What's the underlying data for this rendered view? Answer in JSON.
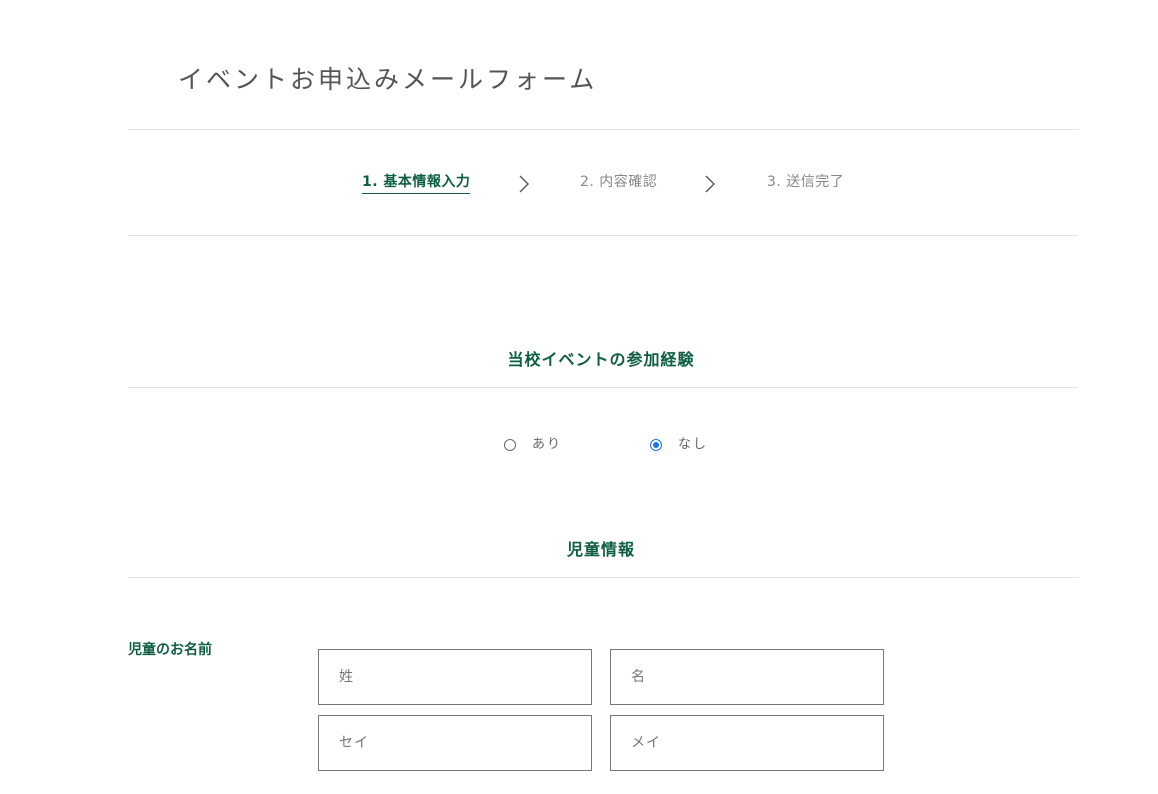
{
  "header": {
    "title": "イベントお申込みメールフォーム"
  },
  "steps": [
    {
      "label": "1. 基本情報入力",
      "active": true
    },
    {
      "label": "2. 内容確認",
      "active": false
    },
    {
      "label": "3. 送信完了",
      "active": false
    }
  ],
  "experience_section": {
    "title": "当校イベントの参加経験",
    "options": [
      {
        "label": "あり",
        "checked": false
      },
      {
        "label": "なし",
        "checked": true
      }
    ]
  },
  "child_section": {
    "title": "児童情報",
    "name_field": {
      "label": "児童のお名前",
      "last_name_placeholder": "姓",
      "first_name_placeholder": "名",
      "last_kana_placeholder": "セイ",
      "first_kana_placeholder": "メイ"
    }
  },
  "colors": {
    "accent": "#0e5e44",
    "radio_checked": "#1a73e8",
    "divider": "#e3e3e3"
  },
  "icons": [
    "chevron-right-icon",
    "chevron-right-icon"
  ]
}
